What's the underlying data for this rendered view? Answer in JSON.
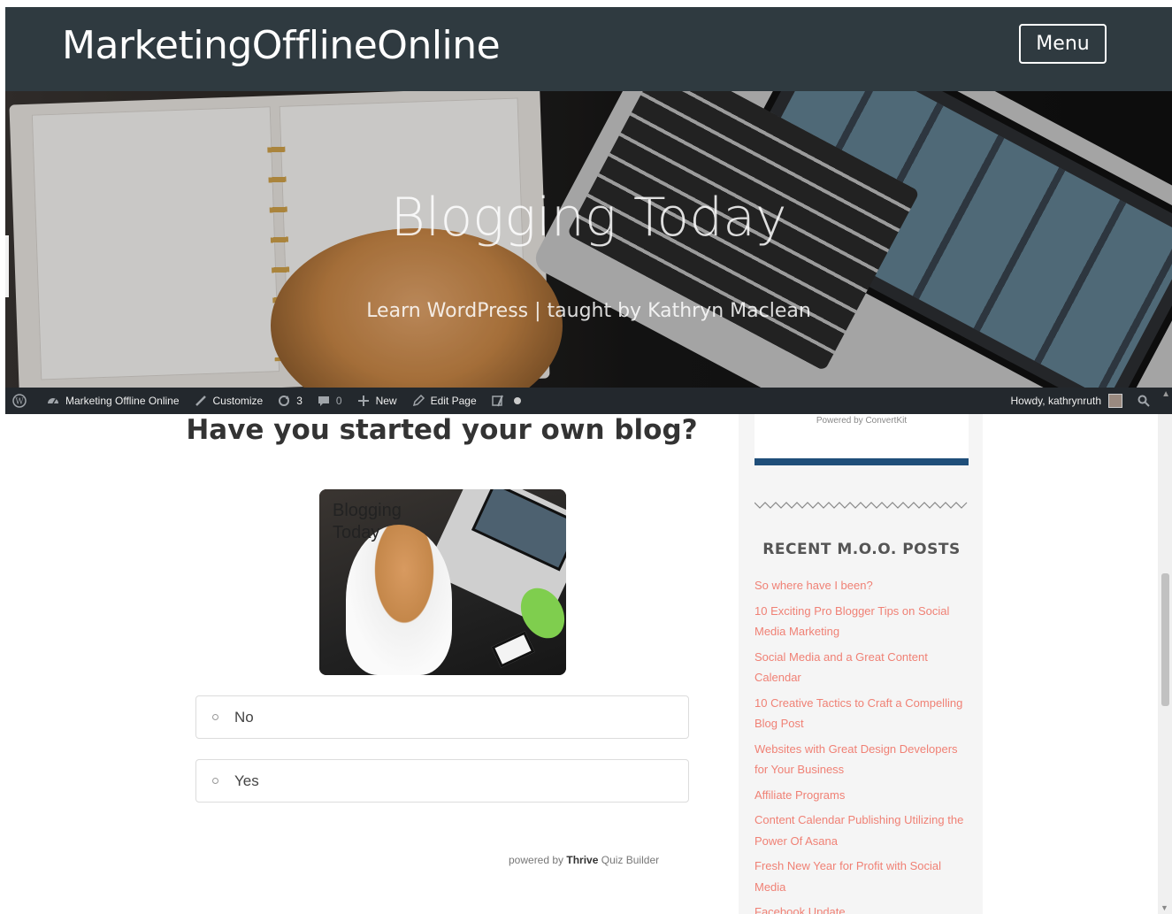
{
  "header": {
    "site_title": "MarketingOfflineOnline",
    "menu_label": "Menu"
  },
  "hero": {
    "title": "Blogging Today",
    "subtitle": "Learn WordPress | taught by Kathryn Maclean"
  },
  "admin_bar": {
    "site_name": "Marketing Offline Online",
    "customize": "Customize",
    "updates_count": "3",
    "comments_count": "0",
    "new": "New",
    "edit_page": "Edit Page",
    "howdy": "Howdy, kathrynruth"
  },
  "quiz": {
    "question": "Have you started your own blog?",
    "image_label_line1": "Blogging",
    "image_label_line2": "Today",
    "answers": [
      "No",
      "Yes"
    ],
    "powered_prefix": "powered by",
    "powered_brand": "Thrive",
    "powered_suffix": "Quiz Builder"
  },
  "sidebar": {
    "convertkit_powered": "Powered by ConvertKit",
    "recent_title": "RECENT M.O.O. POSTS",
    "posts": [
      "So where have I been?",
      "10 Exciting Pro Blogger Tips on Social Media Marketing",
      "Social Media and a Great Content Calendar",
      "10 Creative Tactics to Craft a Compelling Blog Post",
      "Websites with Great Design Developers for Your Business",
      "Affiliate Programs",
      "Content Calendar Publishing Utilizing the Power Of Asana",
      "Fresh New Year for Profit with Social Media",
      "Facebook Update"
    ]
  },
  "colors": {
    "header_bg": "#2f3a40",
    "admin_bar_bg": "#23282d",
    "link_accent": "#f08175",
    "convertkit_bar": "#1f4e79"
  }
}
